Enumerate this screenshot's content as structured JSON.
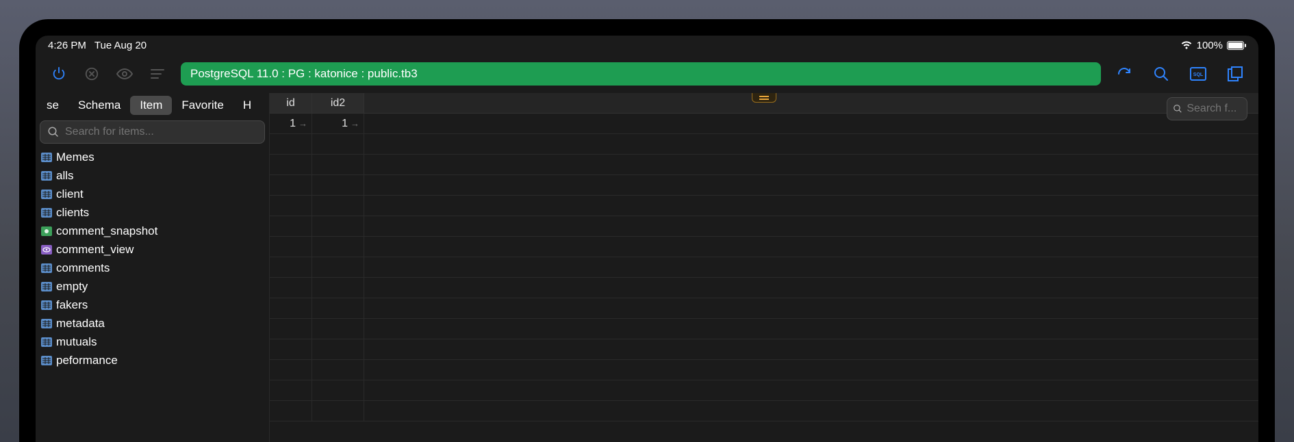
{
  "status_bar": {
    "time": "4:26 PM",
    "date": "Tue Aug 20",
    "battery_pct": "100%"
  },
  "toolbar": {
    "breadcrumb": "PostgreSQL 11.0 : PG : katonice : public.tb3"
  },
  "sidebar": {
    "tabs": [
      "se",
      "Schema",
      "Item",
      "Favorite",
      "H"
    ],
    "active_tab_index": 2,
    "search_placeholder": "Search for items...",
    "items": [
      {
        "label": "Memes",
        "kind": "table"
      },
      {
        "label": "alls",
        "kind": "table"
      },
      {
        "label": "client",
        "kind": "table"
      },
      {
        "label": "clients",
        "kind": "table"
      },
      {
        "label": "comment_snapshot",
        "kind": "materialized_view"
      },
      {
        "label": "comment_view",
        "kind": "view"
      },
      {
        "label": "comments",
        "kind": "table"
      },
      {
        "label": "empty",
        "kind": "table"
      },
      {
        "label": "fakers",
        "kind": "table"
      },
      {
        "label": "metadata",
        "kind": "table"
      },
      {
        "label": "mutuals",
        "kind": "table"
      },
      {
        "label": "peformance",
        "kind": "table"
      }
    ]
  },
  "grid": {
    "columns": [
      "id",
      "id2"
    ],
    "rows": [
      {
        "id": "1",
        "id2": "1"
      }
    ]
  },
  "right_search": {
    "placeholder": "Search f..."
  },
  "colors": {
    "accent_green": "#1e9d52",
    "accent_blue": "#2f84ff",
    "icon_blue": "#5b8dc9",
    "icon_green": "#3ca05a",
    "icon_purple": "#8a5fc4",
    "handle_orange": "#e8a53a"
  }
}
